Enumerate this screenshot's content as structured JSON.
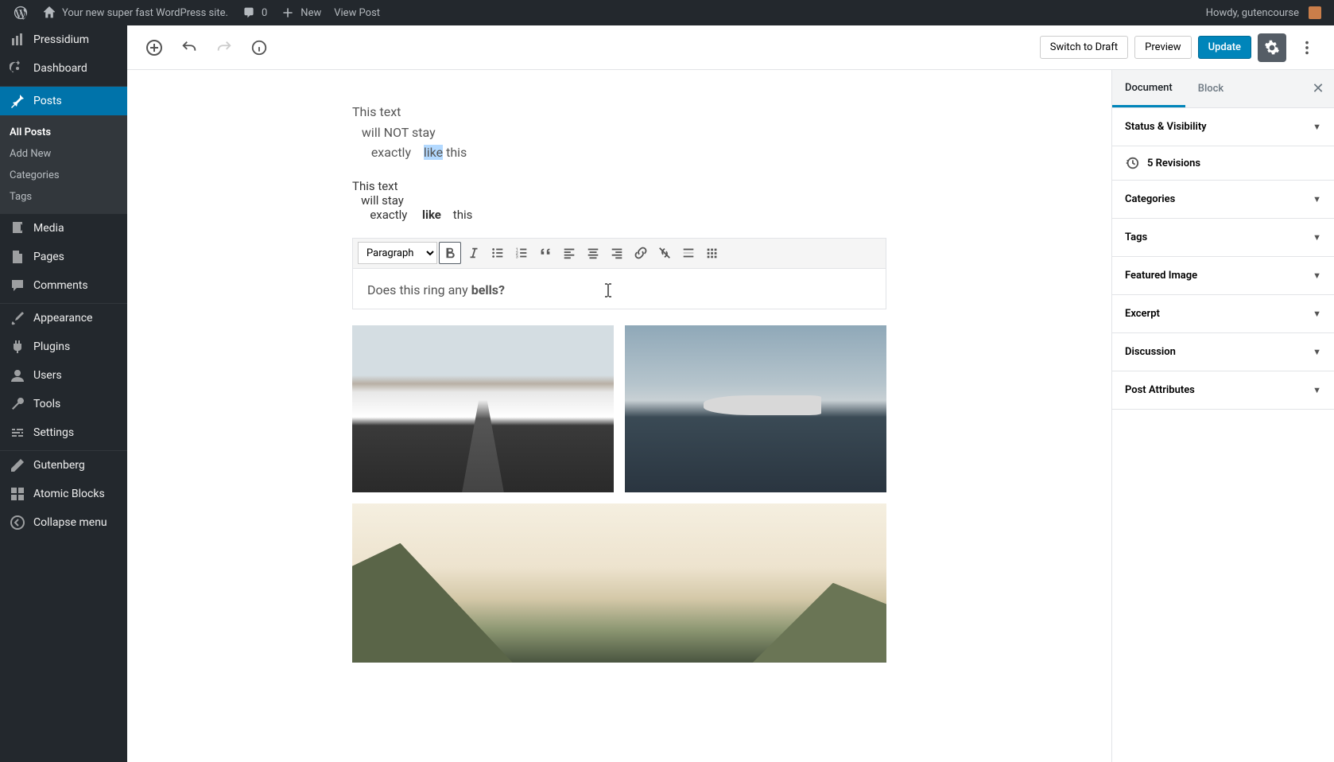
{
  "adminBar": {
    "siteTitle": "Your new super fast WordPress site.",
    "commentsCount": "0",
    "newLabel": "New",
    "viewPostLabel": "View Post",
    "greeting": "Howdy, gutencourse"
  },
  "sidebar": {
    "pressidium": "Pressidium",
    "dashboard": "Dashboard",
    "posts": "Posts",
    "postsSubmenu": {
      "allPosts": "All Posts",
      "addNew": "Add New",
      "categories": "Categories",
      "tags": "Tags"
    },
    "media": "Media",
    "pages": "Pages",
    "comments": "Comments",
    "appearance": "Appearance",
    "plugins": "Plugins",
    "users": "Users",
    "tools": "Tools",
    "settings": "Settings",
    "gutenberg": "Gutenberg",
    "atomicBlocks": "Atomic Blocks",
    "collapse": "Collapse menu"
  },
  "header": {
    "switchDraft": "Switch to Draft",
    "preview": "Preview",
    "update": "Update"
  },
  "content": {
    "para1_part1": "This text",
    "para1_part2": "will NOT stay",
    "para1_part3a": "exactly    ",
    "para1_highlight": "like",
    "para1_part3b": " this",
    "verse": "This text\n   will stay\n      exactly     like    this",
    "formatSelect": "Paragraph",
    "classic_part1": "Does this ring any ",
    "classic_bold": "bells?"
  },
  "settingsPanel": {
    "tabs": {
      "document": "Document",
      "block": "Block"
    },
    "statusVisibility": "Status & Visibility",
    "revisionsCount": "5 Revisions",
    "categories": "Categories",
    "tags": "Tags",
    "featuredImage": "Featured Image",
    "excerpt": "Excerpt",
    "discussion": "Discussion",
    "postAttributes": "Post Attributes"
  }
}
